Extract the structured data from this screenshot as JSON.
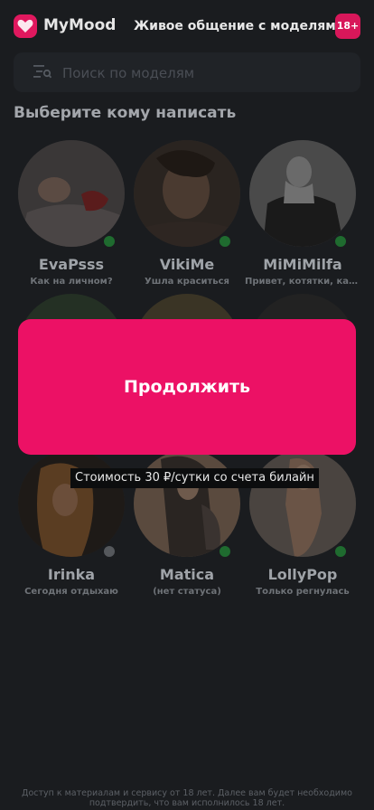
{
  "header": {
    "app_name": "MyMood",
    "title": "Живое общение с моделями",
    "age_badge": "18+"
  },
  "search": {
    "placeholder": "Поиск по моделям"
  },
  "section_title": "Выберите кому написать",
  "models": [
    {
      "name": "EvaPsss",
      "status": "Как на личном?",
      "online": true
    },
    {
      "name": "VikiMe",
      "status": "Ушла краситься",
      "online": true
    },
    {
      "name": "MiMiMilfa",
      "status": "Привет, котятки, как дела?",
      "online": true
    },
    {
      "name": "Irinka",
      "status": "Сегодня отдыхаю",
      "online": false
    },
    {
      "name": "Matica",
      "status": "(нет статуса)",
      "online": true
    },
    {
      "name": "LollyPop",
      "status": "Только регнулась",
      "online": true
    }
  ],
  "colors": {
    "accent": "#ec1165",
    "online": "#2bb34a",
    "offline": "#6b6e73"
  },
  "modal": {
    "button_label": "Продолжить",
    "price_note": "Стоимость 30 ₽/сутки со счета билайн"
  },
  "footer": {
    "disclaimer": "Доступ к материалам и сервису от 18 лет. Далее вам будет необходимо подтвердить, что вам исполнилось 18 лет."
  }
}
